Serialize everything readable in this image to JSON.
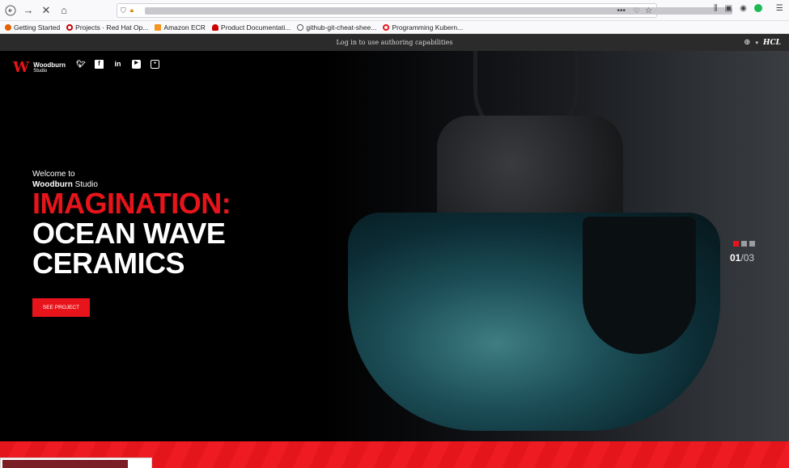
{
  "browser": {
    "bookmarks": [
      {
        "label": "Getting Started",
        "color": "#e66000"
      },
      {
        "label": "Projects · Red Hat Op...",
        "color": "#cc0000"
      },
      {
        "label": "Amazon ECR",
        "color": "#f7941d"
      },
      {
        "label": "Product Documentati...",
        "color": "#cc0000"
      },
      {
        "label": "github-git-cheat-shee...",
        "color": "#555555"
      },
      {
        "label": "Programming Kubern...",
        "color": "#e8141b"
      }
    ]
  },
  "authbar": {
    "message": "Log in to use authoring capabilities",
    "brand": "HCL"
  },
  "site": {
    "brand_name": "Woodburn",
    "brand_sub": "Studio",
    "logo_letter": "W",
    "welcome_line1": "Welcome to",
    "welcome_brand": "Woodburn",
    "welcome_rest": " Studio",
    "headline_red": "IMAGINATION:",
    "headline_line2": "OCEAN WAVE",
    "headline_line3": "CERAMICS",
    "cta_label": "SEE PROJECT",
    "slide_current": "01",
    "slide_total": "/03",
    "accent_color": "#e8141b"
  }
}
